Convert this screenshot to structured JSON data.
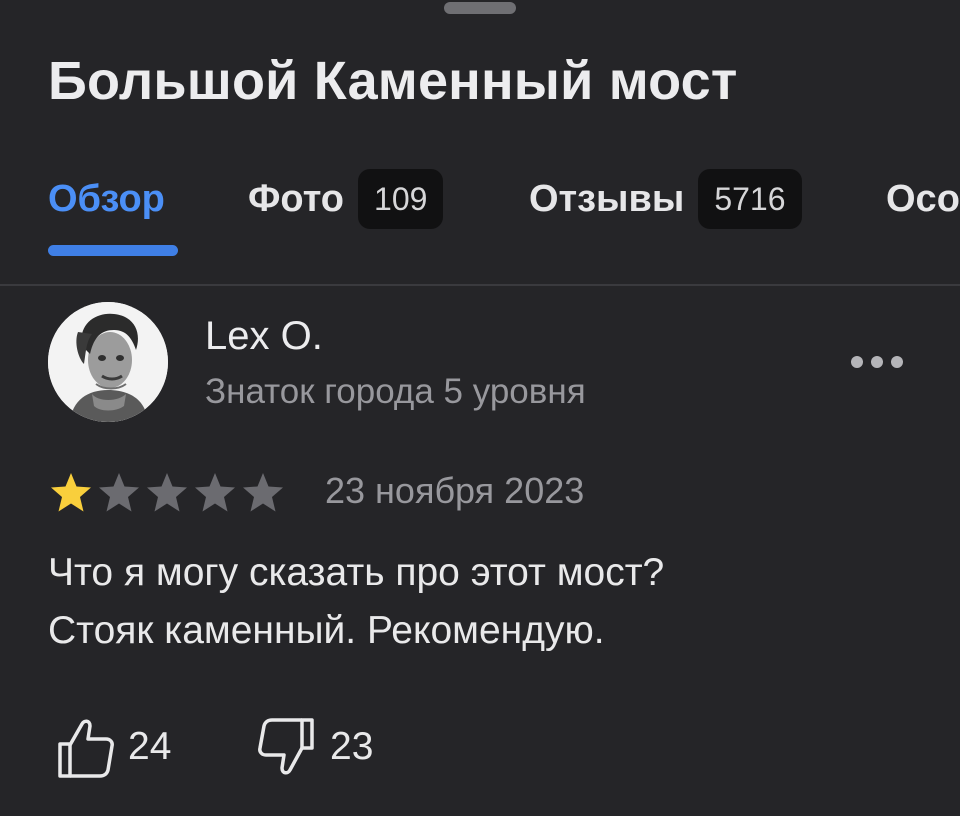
{
  "place": {
    "title": "Большой Каменный мост"
  },
  "tabs": [
    {
      "label": "Обзор",
      "badge": null,
      "active": true
    },
    {
      "label": "Фото",
      "badge": "109",
      "active": false
    },
    {
      "label": "Отзывы",
      "badge": "5716",
      "active": false
    },
    {
      "label": "Осо",
      "badge": null,
      "active": false
    }
  ],
  "review": {
    "author": {
      "name": "Lex O.",
      "level": "Знаток города 5 уровня",
      "avatar_icon": "user-avatar-photo"
    },
    "more_icon": "more-horizontal-icon",
    "rating": 1,
    "rating_max": 5,
    "date": "23 ноября 2023",
    "text_lines": [
      "Что я могу сказать про этот мост?",
      "Стояк каменный. Рекомендую."
    ],
    "likes": "24",
    "dislikes": "23"
  },
  "colors": {
    "background": "#252528",
    "accent": "#4b8ff6",
    "star_filled": "#f9cf3c",
    "star_empty": "#6b6b70",
    "secondary_text": "#98989d"
  }
}
